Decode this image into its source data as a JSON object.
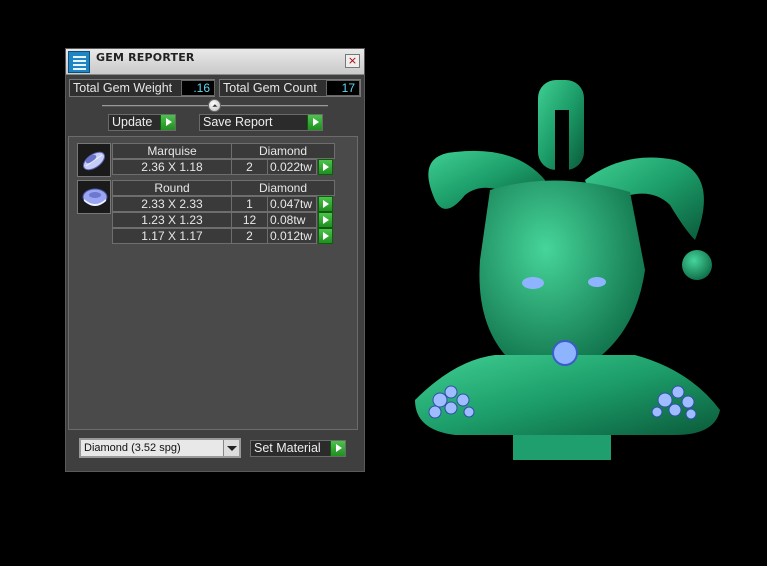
{
  "window": {
    "title": "GEM REPORTER",
    "close_glyph": "×",
    "icon": "app-icon"
  },
  "summary": {
    "weight_label": "Total Gem Weight",
    "weight_value": ".16",
    "count_label": "Total Gem Count",
    "count_value": "17"
  },
  "slider": {
    "thumb_glyph": "⏶"
  },
  "toolbar": {
    "update_label": "Update",
    "save_label": "Save Report"
  },
  "groups": [
    {
      "shape": "Marquise",
      "material": "Diamond",
      "icon": "marquise-gem-icon",
      "rows": [
        {
          "size": "2.36 X 1.18",
          "count": "2",
          "weight": "0.022tw"
        }
      ]
    },
    {
      "shape": "Round",
      "material": "Diamond",
      "icon": "round-gem-icon",
      "rows": [
        {
          "size": "2.33 X 2.33",
          "count": "1",
          "weight": "0.047tw"
        },
        {
          "size": "1.23 X 1.23",
          "count": "12",
          "weight": "0.08tw"
        },
        {
          "size": "1.17 X 1.17",
          "count": "2",
          "weight": "0.012tw"
        }
      ]
    }
  ],
  "material_select": {
    "value": "Diamond    (3.52 spg)"
  },
  "set_material_label": "Set Material",
  "colors": {
    "accent_green": "#2aa52a",
    "value_cyan": "#5fd7ef",
    "model_green": "#1e9a6a",
    "gem_blue": "#8fb4ff"
  }
}
